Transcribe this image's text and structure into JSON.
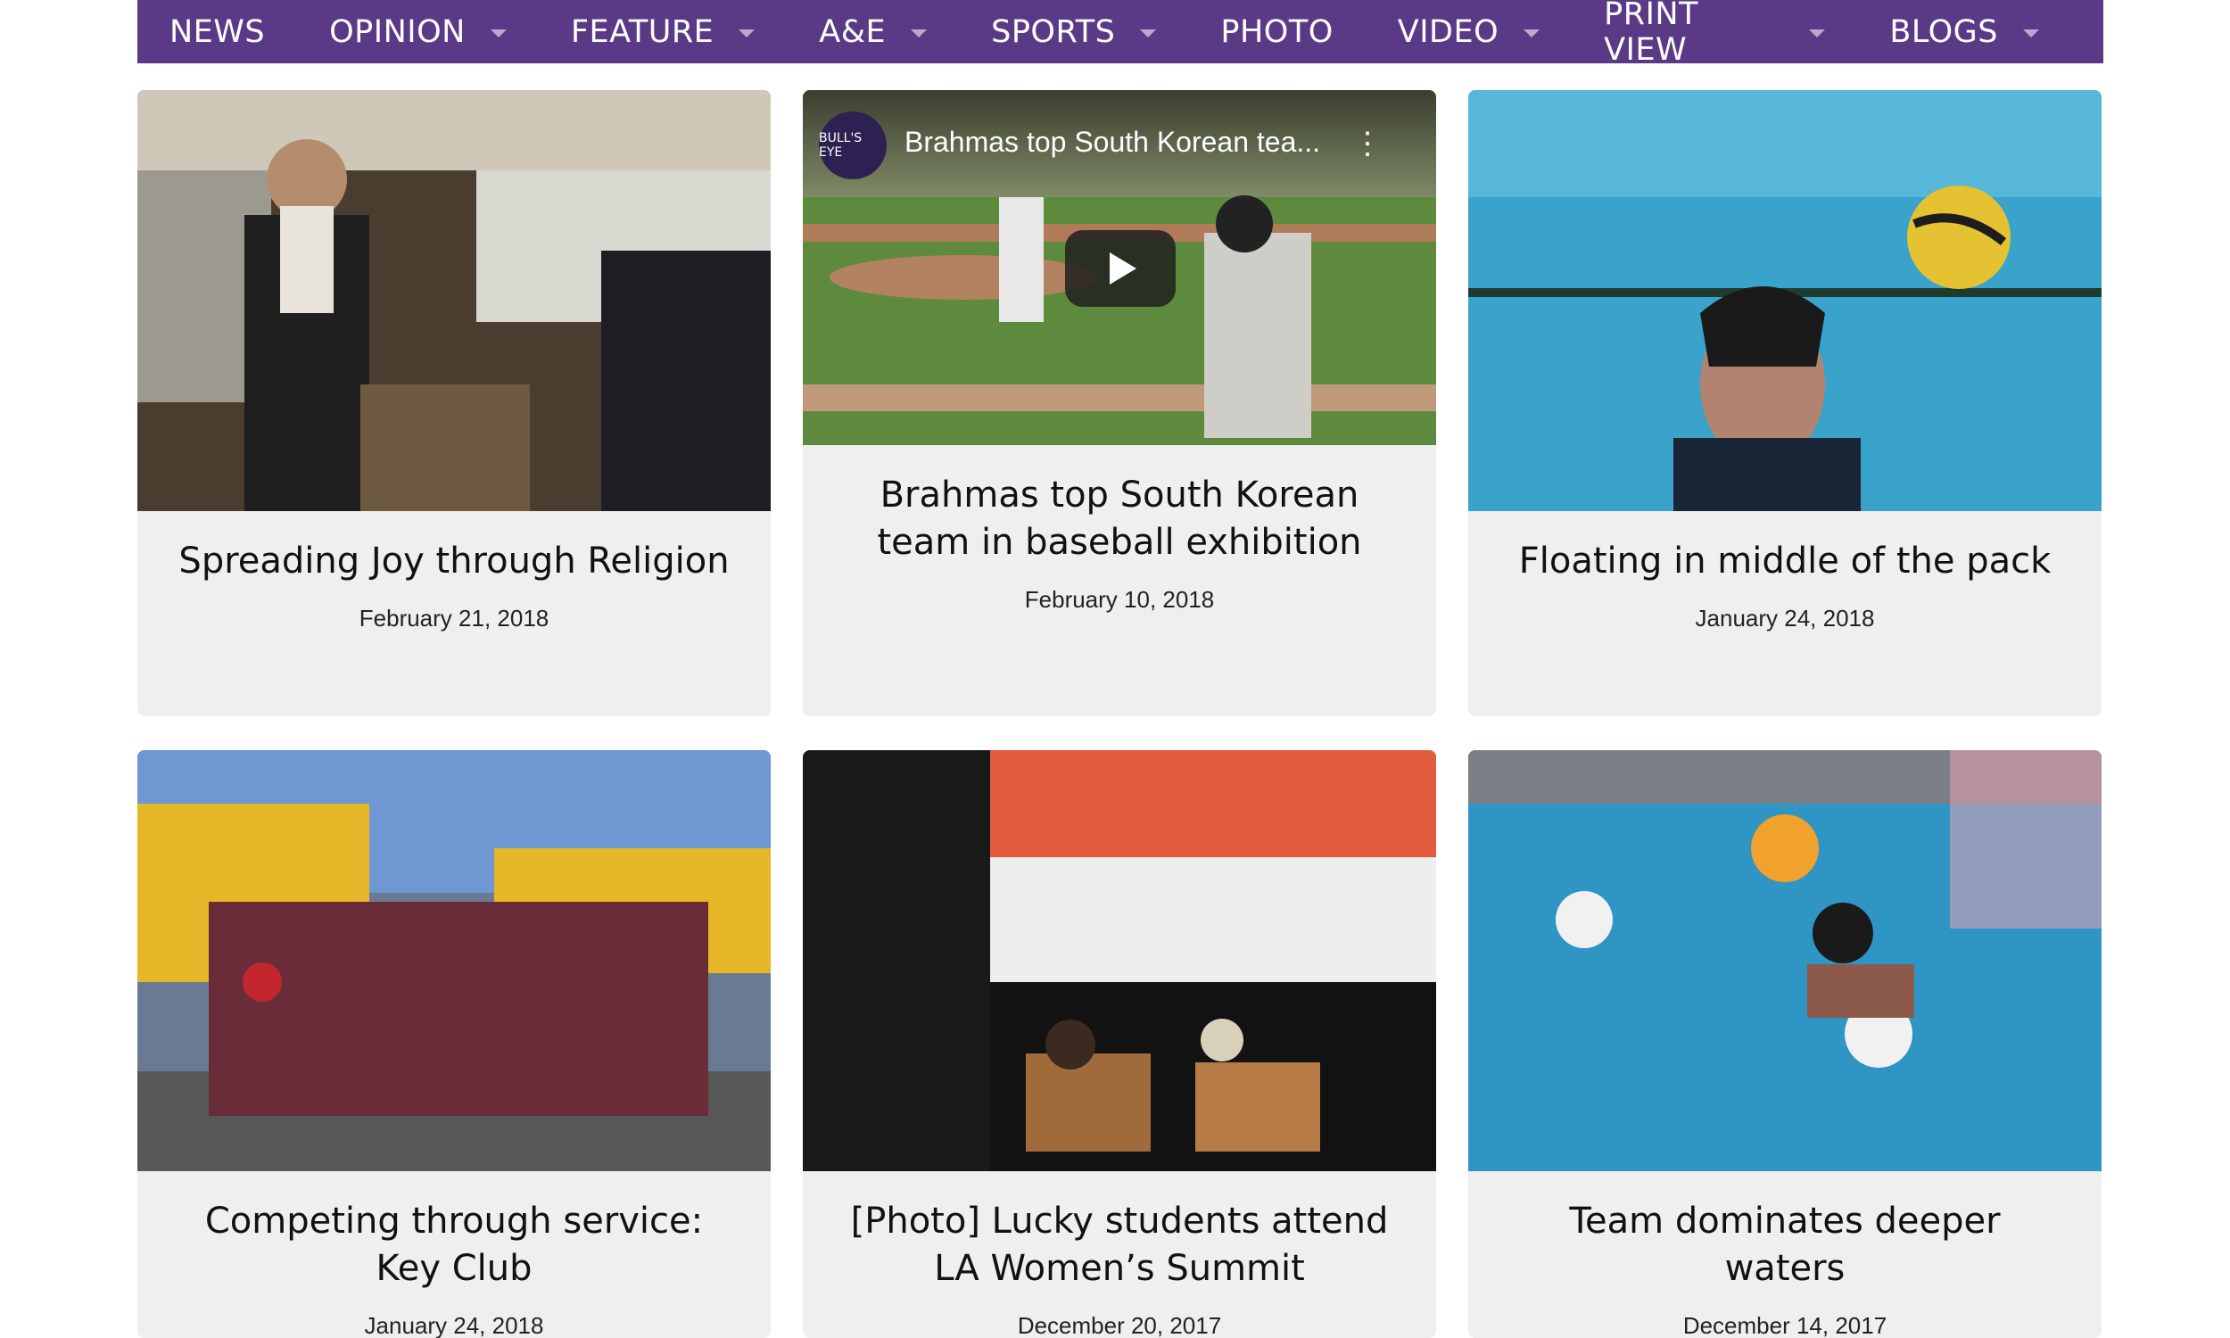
{
  "nav": {
    "items": [
      {
        "label": "NEWS",
        "dropdown": false
      },
      {
        "label": "OPINION",
        "dropdown": true
      },
      {
        "label": "FEATURE",
        "dropdown": true
      },
      {
        "label": "A&E",
        "dropdown": true
      },
      {
        "label": "SPORTS",
        "dropdown": true
      },
      {
        "label": "PHOTO",
        "dropdown": false
      },
      {
        "label": "VIDEO",
        "dropdown": true
      },
      {
        "label": "PRINT VIEW",
        "dropdown": true
      },
      {
        "label": "BLOGS",
        "dropdown": true
      }
    ]
  },
  "cards": [
    {
      "title": "Spreading Joy through Religion",
      "date": "February 21, 2018"
    },
    {
      "title": "Brahmas top South Korean team in baseball exhibition",
      "date": "February 10, 2018",
      "video": {
        "channel_logo": "BULL'S EYE",
        "title": "Brahmas top South Korean tea...",
        "more": "⋮"
      }
    },
    {
      "title": "Floating in middle of the pack",
      "date": "January 24, 2018"
    },
    {
      "title": "Competing through service: Key Club",
      "date": "January 24, 2018"
    },
    {
      "title": "[Photo] Lucky students attend LA Women’s Summit",
      "date": "December 20, 2017"
    },
    {
      "title": "Team dominates deeper waters",
      "date": "December 14, 2017"
    }
  ],
  "colors": {
    "nav_bg": "#5a3a86",
    "card_bg": "#efefef"
  }
}
